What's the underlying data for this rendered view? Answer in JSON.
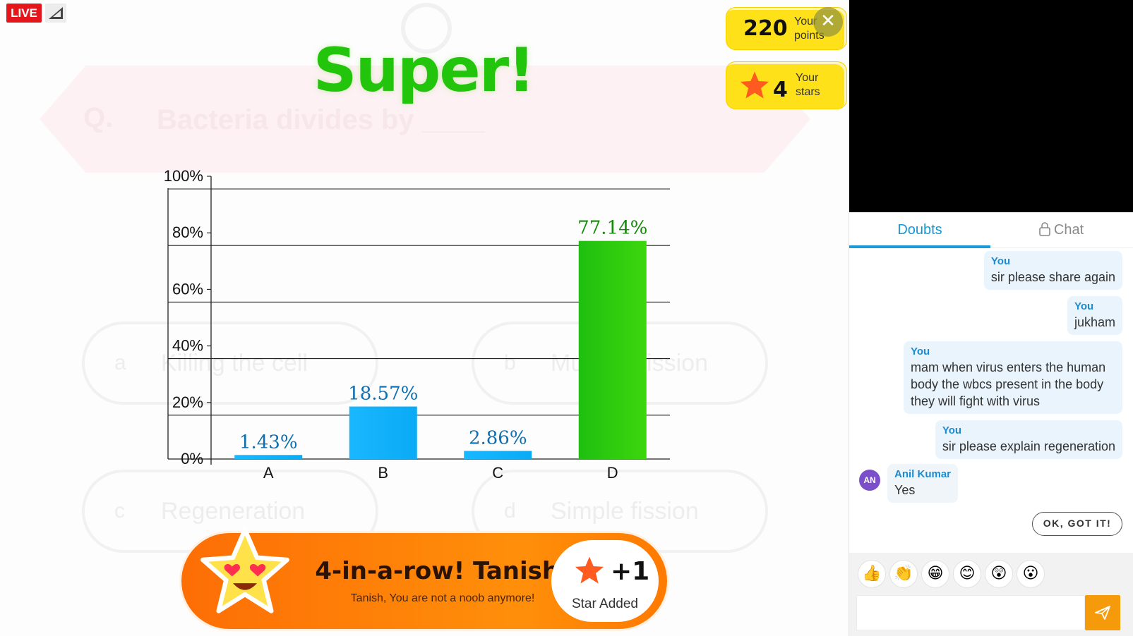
{
  "header": {
    "live_label": "LIVE"
  },
  "result": {
    "title": "Super!"
  },
  "question": {
    "label": "Q.",
    "text": "Bacteria divides by ____",
    "options": [
      {
        "key": "a",
        "text": "Killing the cell"
      },
      {
        "key": "b",
        "text": "Multiple fission"
      },
      {
        "key": "c",
        "text": "Regeneration"
      },
      {
        "key": "d",
        "text": "Simple fission"
      }
    ]
  },
  "scores": {
    "points_value": "220",
    "points_label_1": "Your",
    "points_label_2": "points",
    "stars_value": "4",
    "stars_label_1": "Your",
    "stars_label_2": "stars"
  },
  "streak": {
    "title": "4-in-a-row! Tanish!",
    "subtitle": "Tanish, You are not a noob anymore!",
    "plus": "+1",
    "added_label": "Star Added"
  },
  "chart_data": {
    "type": "bar",
    "categories": [
      "A",
      "B",
      "C",
      "D"
    ],
    "values": [
      1.43,
      18.57,
      2.86,
      77.14
    ],
    "labels": [
      "1.43%",
      "18.57%",
      "2.86%",
      "77.14%"
    ],
    "y_ticks": [
      "0%",
      "20%",
      "40%",
      "60%",
      "80%",
      "100%"
    ],
    "ylim": [
      0,
      100
    ],
    "correct_index": 3,
    "colors": {
      "normal": "#0aaaf5",
      "correct": "#1fbf10",
      "normal_label": "#0c6fb1",
      "correct_label": "#138a06"
    }
  },
  "panel": {
    "tabs": {
      "doubts": "Doubts",
      "chat": "Chat"
    },
    "messages": [
      {
        "who": "You",
        "text": "sir please share again"
      },
      {
        "who": "You",
        "text": "jukham"
      },
      {
        "who": "You",
        "text": "mam when virus enters the human body the wbcs present in the body they will fight with virus"
      },
      {
        "who": "You",
        "text": "sir please explain regeneration"
      },
      {
        "who": "Anil Kumar",
        "initials": "AN",
        "text": "Yes"
      }
    ],
    "ok_button": "OK, GOT IT!",
    "emojis": [
      "👍",
      "👏",
      "😁",
      "😊",
      "😲",
      "😮"
    ],
    "input_placeholder": ""
  }
}
